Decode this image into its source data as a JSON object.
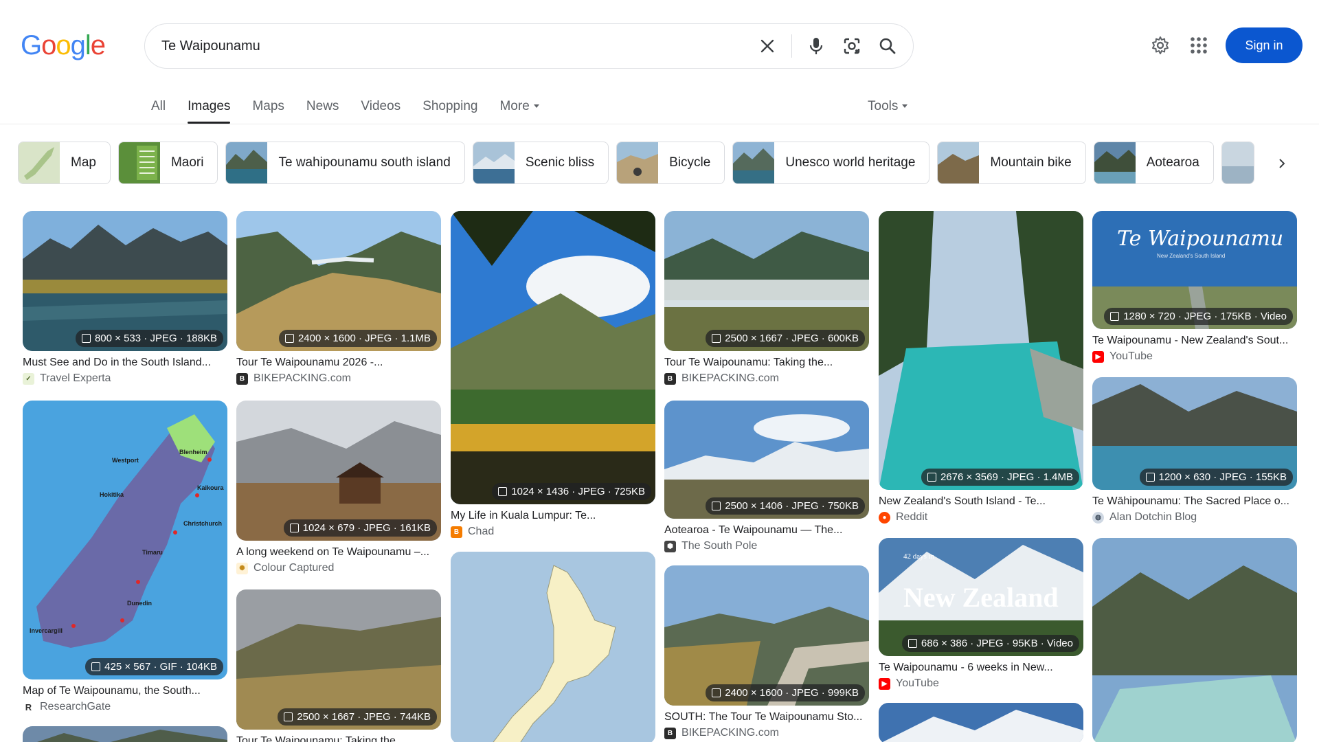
{
  "header": {
    "logo_letters": [
      "G",
      "o",
      "o",
      "g",
      "l",
      "e"
    ],
    "logo_colors": [
      "#4285F4",
      "#EA4335",
      "#FBBC05",
      "#4285F4",
      "#34A853",
      "#EA4335"
    ],
    "search_value": "Te Waipounamu",
    "signin_label": "Sign in"
  },
  "tabs": [
    {
      "label": "All"
    },
    {
      "label": "Images",
      "active": true
    },
    {
      "label": "Maps"
    },
    {
      "label": "News"
    },
    {
      "label": "Videos"
    },
    {
      "label": "Shopping"
    },
    {
      "label": "More"
    }
  ],
  "tools_label": "Tools",
  "chips": [
    {
      "label": "Map"
    },
    {
      "label": "Maori"
    },
    {
      "label": "Te wahipounamu south island"
    },
    {
      "label": "Scenic bliss"
    },
    {
      "label": "Bicycle"
    },
    {
      "label": "Unesco world heritage"
    },
    {
      "label": "Mountain bike"
    },
    {
      "label": "Aotearoa"
    }
  ],
  "results": [
    {
      "meta": "800 × 533 · JPEG · 188KB",
      "title": "Must See and Do in the South Island...",
      "source": "Travel Experta",
      "favicon": "travel-experta-icon"
    },
    {
      "meta": "425 × 567 · GIF · 104KB",
      "title": "Map of Te Waipounamu, the South...",
      "source": "ResearchGate",
      "favicon": "researchgate-icon"
    },
    {
      "meta": "",
      "title": "",
      "source": "",
      "favicon": ""
    },
    {
      "meta": "2400 × 1600 · JPEG · 1.1MB",
      "title": "Tour Te Waipounamu 2026 -...",
      "source": "BIKEPACKING.com",
      "favicon": "bikepacking-icon"
    },
    {
      "meta": "1024 × 679 · JPEG · 161KB",
      "title": "A long weekend on Te Waipounamu –...",
      "source": "Colour Captured",
      "favicon": "colour-captured-icon"
    },
    {
      "meta": "2500 × 1667 · JPEG · 744KB",
      "title": "Tour Te Waipounamu: Taking the...",
      "source": "",
      "favicon": ""
    },
    {
      "meta": "1024 × 1436 · JPEG · 725KB",
      "title": "My Life in Kuala Lumpur: Te...",
      "source": "Chad",
      "favicon": "blogger-icon"
    },
    {
      "meta": "",
      "title": "",
      "source": "",
      "favicon": ""
    },
    {
      "meta": "2500 × 1667 · JPEG · 600KB",
      "title": "Tour Te Waipounamu: Taking the...",
      "source": "BIKEPACKING.com",
      "favicon": "bikepacking-icon"
    },
    {
      "meta": "2500 × 1406 · JPEG · 750KB",
      "title": "Aotearoa - Te Waipounamu — The...",
      "source": "The South Pole",
      "favicon": "south-pole-icon"
    },
    {
      "meta": "2400 × 1600 · JPEG · 999KB",
      "title": "SOUTH: The Tour Te Waipounamu Sto...",
      "source": "BIKEPACKING.com",
      "favicon": "bikepacking-icon"
    },
    {
      "meta": "2676 × 3569 · JPEG · 1.4MB",
      "title": "New Zealand's South Island - Te...",
      "source": "Reddit",
      "favicon": "reddit-icon"
    },
    {
      "meta": "686 × 386 · JPEG · 95KB · Video",
      "title": "Te Waipounamu - 6 weeks in New...",
      "source": "YouTube",
      "favicon": "youtube-icon"
    },
    {
      "meta": "",
      "title": "",
      "source": "",
      "favicon": ""
    },
    {
      "meta": "1280 × 720 · JPEG · 175KB · Video",
      "title": "Te Waipounamu - New Zealand's Sout...",
      "source": "YouTube",
      "favicon": "youtube-icon"
    },
    {
      "meta": "1200 × 630 · JPEG · 155KB",
      "title": "Te Wāhipounamu: The Sacred Place o...",
      "source": "Alan Dotchin Blog",
      "favicon": "globe-icon"
    },
    {
      "meta": "",
      "title": "",
      "source": "",
      "favicon": ""
    }
  ],
  "overlay_text": {
    "video_title": "Te Waipounamu",
    "video_subtitle": "New Zealand's South Island",
    "nz_title": "New Zealand",
    "nz_small": "42 days in",
    "map_labels": [
      "Westport",
      "Blenheim",
      "Hokitika",
      "Kaikoura",
      "Christchurch",
      "Timaru",
      "Dunedin",
      "Invercargill"
    ]
  }
}
